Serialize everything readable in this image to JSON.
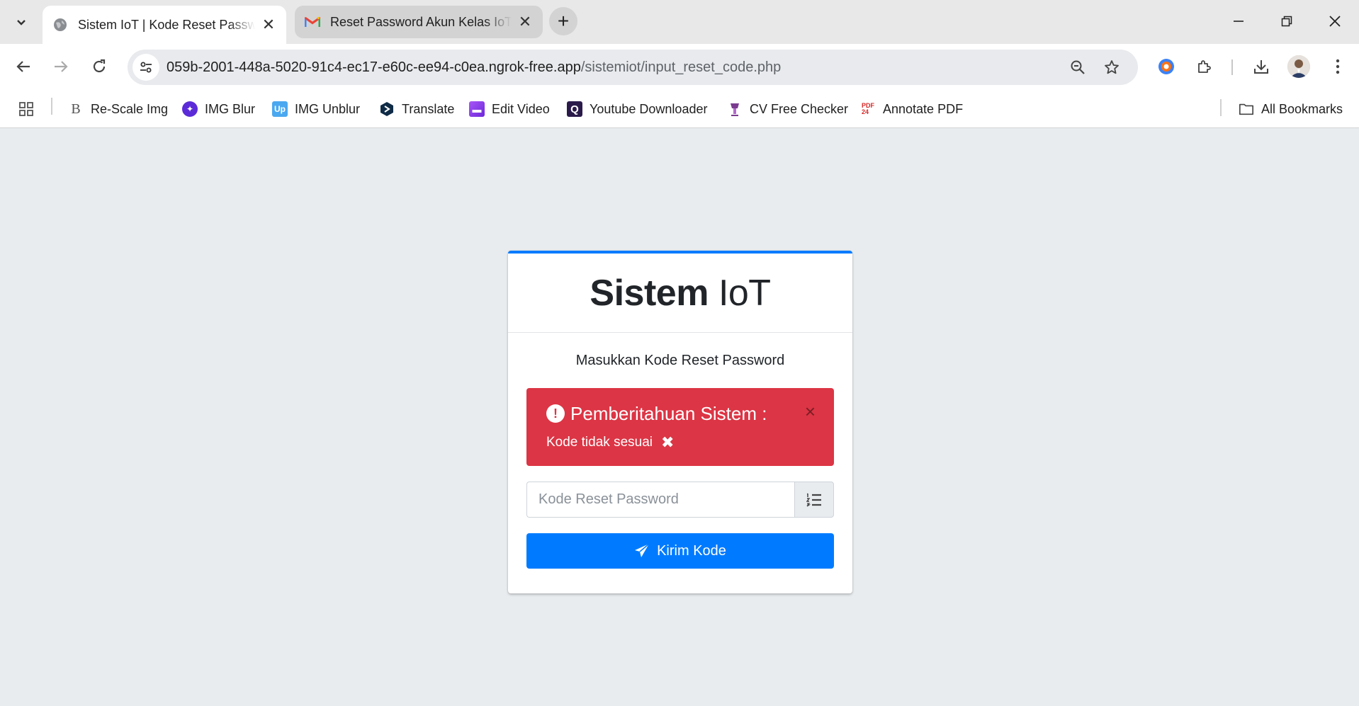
{
  "browser": {
    "tabs": [
      {
        "title": "Sistem IoT | Kode Reset Password",
        "active": true
      },
      {
        "title": "Reset Password Akun Kelas IoT",
        "active": false
      }
    ],
    "url_host": "059b-2001-448a-5020-91c4-ec17-e60c-ee94-c0ea.ngrok-free.app",
    "url_path": "/sistemiot/input_reset_code.php",
    "bookmarks": [
      {
        "label": "Re-Scale Img",
        "icon": "rescale-icon",
        "color": "#555555"
      },
      {
        "label": "IMG Blur",
        "icon": "imgblur-icon",
        "color": "#5b2bd8"
      },
      {
        "label": "IMG Unblur",
        "icon": "imgunblur-icon",
        "color": "#4aa8f0"
      },
      {
        "label": "Translate",
        "icon": "translate-icon",
        "color": "#0f2b46"
      },
      {
        "label": "Edit Video",
        "icon": "editvideo-icon",
        "color": "#7b4de0"
      },
      {
        "label": "Youtube Downloader",
        "icon": "youtube-downloader-icon",
        "color": "#2a1a4a"
      },
      {
        "label": "CV Free Checker",
        "icon": "cv-checker-icon",
        "color": "#7a3b8f"
      },
      {
        "label": "Annotate PDF",
        "icon": "pdf24-icon",
        "color": "#d62828"
      }
    ],
    "all_bookmarks": "All Bookmarks"
  },
  "page": {
    "logo_bold": "Sistem",
    "logo_light": "IoT",
    "login_msg": "Masukkan Kode Reset Password",
    "alert": {
      "title": "Pemberitahuan Sistem :",
      "message": "Kode tidak sesuai",
      "close": "×",
      "color": "#dc3545"
    },
    "input_placeholder": "Kode Reset Password",
    "submit_label": "Kirim Kode",
    "accent": "#007bff"
  }
}
